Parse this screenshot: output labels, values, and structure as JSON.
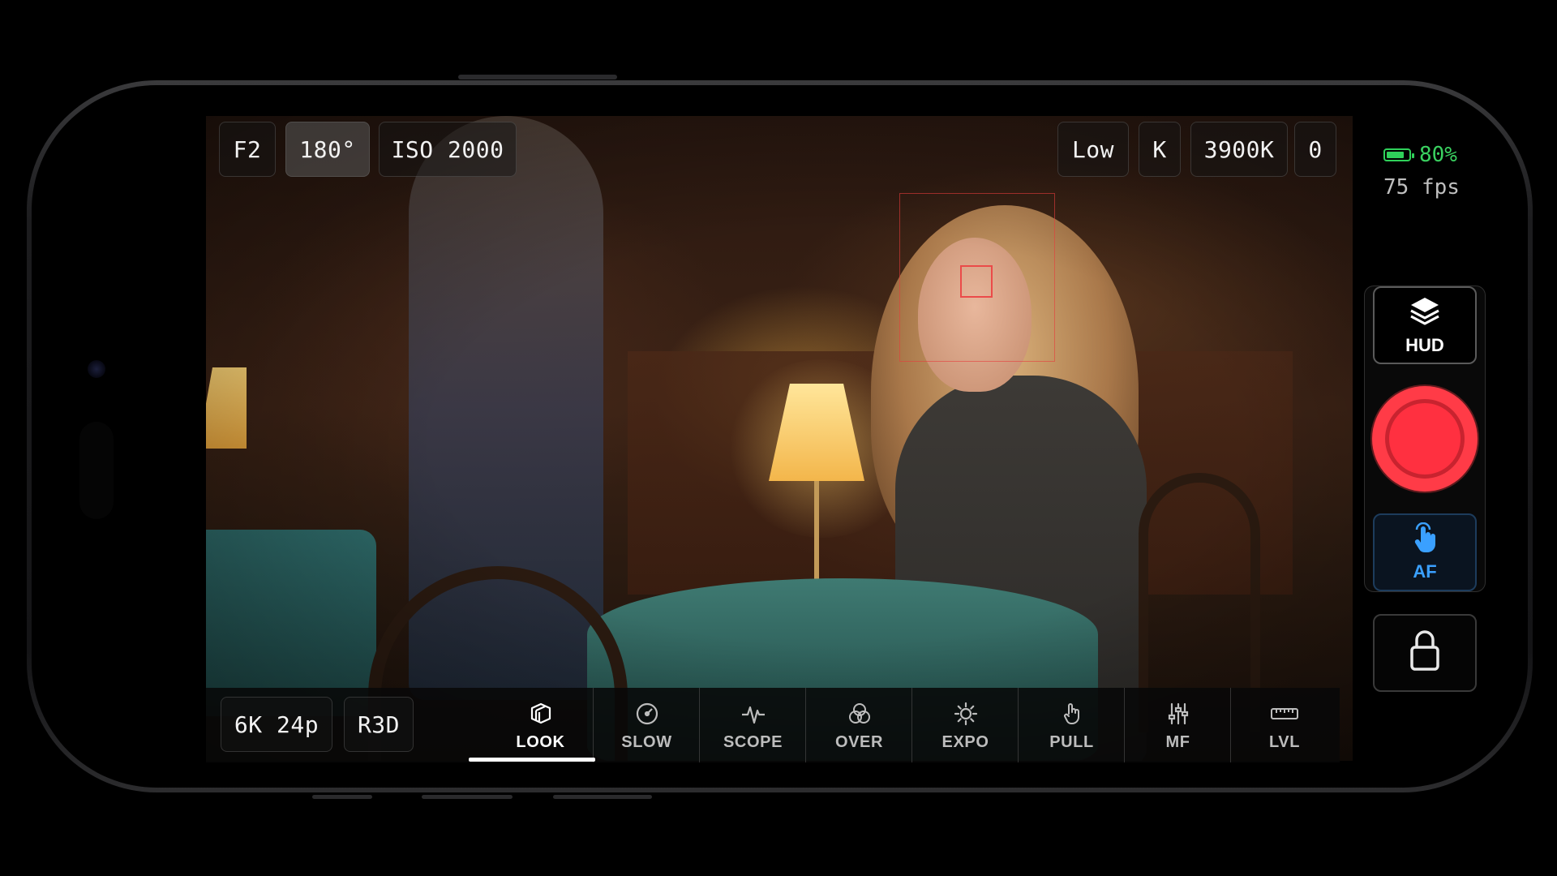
{
  "colors": {
    "battery": "#2fd15a",
    "record": "#ff3b47",
    "af_accent": "#3aa0ff",
    "focus_box": "#e63c3c"
  },
  "top_left_chips": [
    {
      "label": "F2",
      "active": false
    },
    {
      "label": "180°",
      "active": true
    },
    {
      "label": "ISO 2000",
      "active": false
    }
  ],
  "top_right_chips": [
    {
      "label": "Low"
    },
    {
      "label": "K"
    },
    {
      "label": "3900K"
    },
    {
      "label": "0"
    }
  ],
  "bottom_left_chips": [
    {
      "label": "6K 24p"
    },
    {
      "label": "R3D"
    }
  ],
  "toolbar": {
    "active": "LOOK",
    "items": [
      {
        "label": "LOOK",
        "icon": "cube-layers-icon"
      },
      {
        "label": "SLOW",
        "icon": "speedometer-icon"
      },
      {
        "label": "SCOPE",
        "icon": "waveform-icon"
      },
      {
        "label": "OVER",
        "icon": "overlay-circles-icon"
      },
      {
        "label": "EXPO",
        "icon": "sun-icon"
      },
      {
        "label": "PULL",
        "icon": "hand-tap-icon"
      },
      {
        "label": "MF",
        "icon": "sliders-icon"
      },
      {
        "label": "LVL",
        "icon": "ruler-icon"
      }
    ]
  },
  "status": {
    "battery_percent": "80%",
    "battery_level": 0.8,
    "fps": "75 fps"
  },
  "side_buttons": {
    "hud_label": "HUD",
    "hud_icon": "layers-icon",
    "record_icon": "record-icon",
    "af_label": "AF",
    "af_icon": "tap-hand-icon",
    "lock_icon": "lock-icon"
  }
}
